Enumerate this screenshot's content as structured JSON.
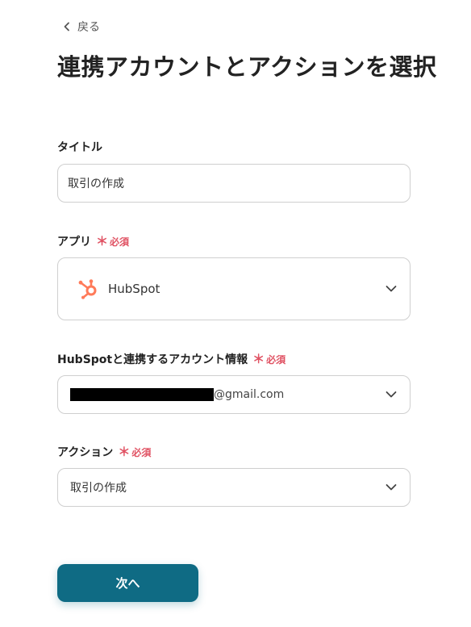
{
  "nav": {
    "back_label": "戻る"
  },
  "page": {
    "title": "連携アカウントとアクションを選択"
  },
  "required_mark": "＊",
  "required_text": "必須",
  "fields": {
    "title": {
      "label": "タイトル",
      "value": "取引の作成"
    },
    "app": {
      "label": "アプリ",
      "value": "HubSpot",
      "icon": "hubspot-logo-icon"
    },
    "account": {
      "label": "HubSpotと連携するアカウント情報",
      "value_suffix": "@gmail.com"
    },
    "action": {
      "label": "アクション",
      "value": "取引の作成"
    }
  },
  "buttons": {
    "next_label": "次へ"
  },
  "colors": {
    "accent": "#0f6b84",
    "required": "#e05263",
    "hubspot": "#ff7a59"
  }
}
